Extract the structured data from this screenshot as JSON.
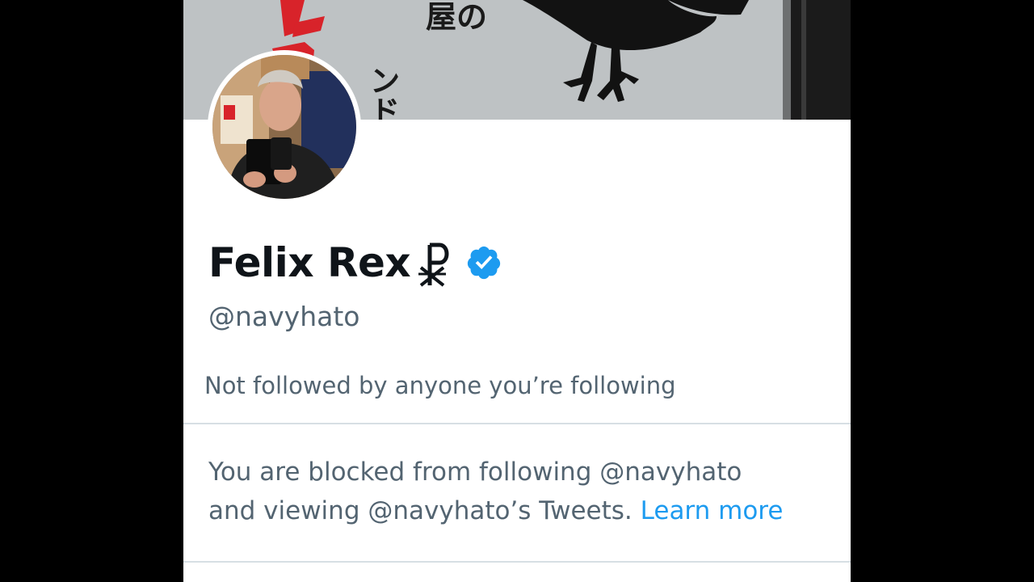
{
  "profile": {
    "display_name": "Felix Rex",
    "handle": "@navyhato",
    "verified": true,
    "name_symbol_icon": "chi-rho-icon",
    "verified_icon": "verified-badge-icon"
  },
  "banner": {
    "japanese_text": [
      "屋の",
      "ンド"
    ]
  },
  "social": {
    "followers_note": "Not followed by anyone you’re following"
  },
  "blocked": {
    "line1": "You are blocked from following @navyhato",
    "line2_prefix": "and viewing @navyhato’s Tweets.",
    "learn_more": "Learn more"
  },
  "colors": {
    "accent": "#1d9bf0",
    "text_primary": "#0f1419",
    "text_secondary": "#536471",
    "divider": "#d7dfe4"
  }
}
